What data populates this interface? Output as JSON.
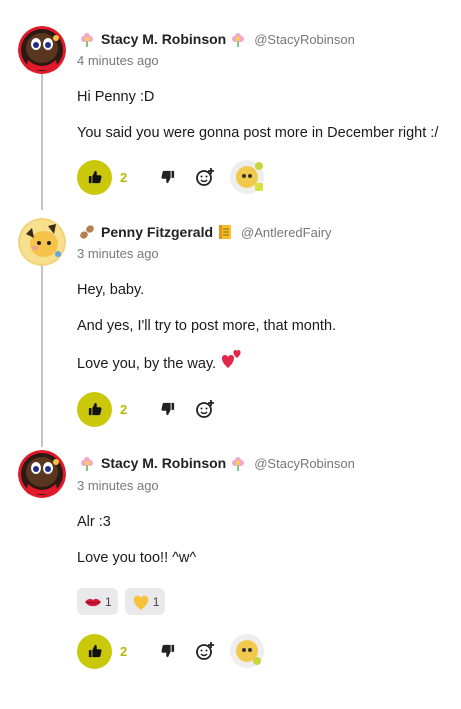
{
  "colors": {
    "like_button_bg": "#c9c80a",
    "like_count": "#b8b60a",
    "thread_line": "#c4c4c4",
    "muted_text": "#777777"
  },
  "comments": [
    {
      "author": "Stacy M. Robinson",
      "handle": "@StacyRobinson",
      "time": "4 minutes ago",
      "flair_before": "flower-icon",
      "flair_after": "flower-icon",
      "avatar": "stacy-avatar",
      "paragraphs": [
        "Hi Penny :D",
        "You said you were gonna post more in December right :/"
      ],
      "likes": "2",
      "has_reactor": true
    },
    {
      "author": "Penny Fitzgerald",
      "handle": "@AntleredFairy",
      "time": "3 minutes ago",
      "flair_before": "peanut-icon",
      "flair_after": "notepad-icon",
      "avatar": "penny-avatar",
      "paragraphs": [
        "Hey, baby.",
        "And yes, I'll try to post more, that month.",
        "Love you, by the way."
      ],
      "trailing_emoji": "two-hearts-icon",
      "likes": "2",
      "has_reactor": false
    },
    {
      "author": "Stacy M. Robinson",
      "handle": "@StacyRobinson",
      "time": "3 minutes ago",
      "flair_before": "flower-icon",
      "flair_after": "flower-icon",
      "avatar": "stacy-avatar",
      "paragraphs": [
        "Alr :3",
        "Love you too!! ^w^"
      ],
      "reactions": [
        {
          "emoji": "kiss-lips-icon",
          "count": "1"
        },
        {
          "emoji": "yellow-heart-icon",
          "count": "1"
        }
      ],
      "likes": "2",
      "has_reactor": true
    }
  ]
}
